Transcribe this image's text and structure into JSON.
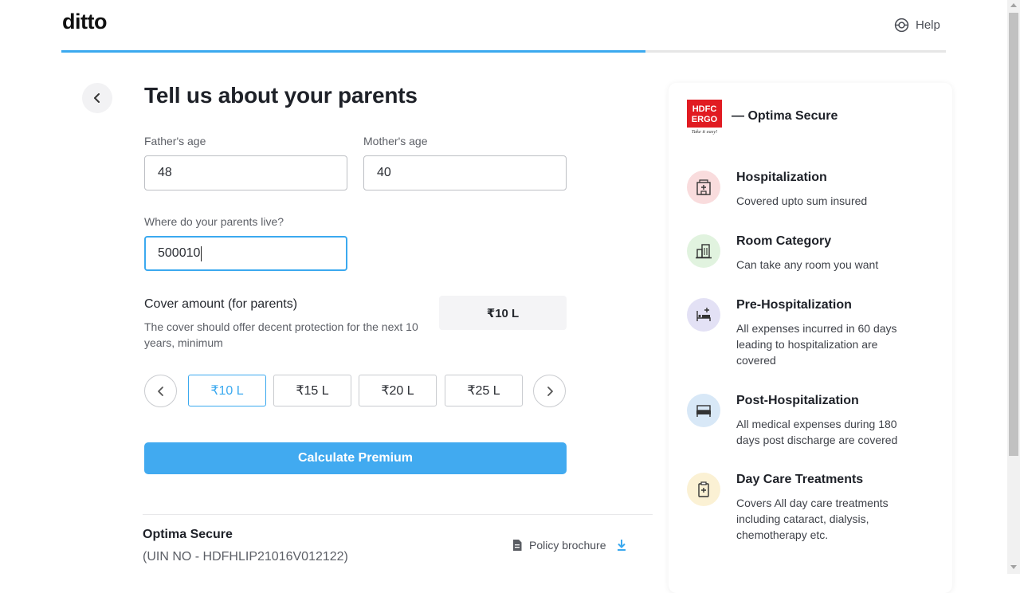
{
  "header": {
    "logo": "ditto",
    "help_label": "Help",
    "progress_percent": 66
  },
  "form": {
    "title": "Tell us about your parents",
    "father_age_label": "Father's age",
    "father_age_value": "48",
    "mother_age_label": "Mother's age",
    "mother_age_value": "40",
    "location_label": "Where do your parents live?",
    "location_value": "500010",
    "cover_title": "Cover amount (for parents)",
    "cover_desc": "The cover should offer decent protection for the next 10 years, minimum",
    "cover_selected": "₹10 L",
    "cover_options": [
      "₹10 L",
      "₹15 L",
      "₹20 L",
      "₹25 L"
    ],
    "calculate_label": "Calculate Premium"
  },
  "plan": {
    "name": "Optima Secure",
    "uin": "(UIN NO - HDFHLIP21016V012122)",
    "brochure_label": "Policy brochure"
  },
  "sidebar": {
    "insurer_logo_text": [
      "HDFC",
      "ERGO",
      "Take it easy!"
    ],
    "plan_title": "— Optima Secure",
    "features": [
      {
        "title": "Hospitalization",
        "desc": "Covered upto sum insured",
        "icon": "hospital-icon",
        "color": "#f9dcdd"
      },
      {
        "title": "Room Category",
        "desc": "Can take any room you want",
        "icon": "building-icon",
        "color": "#e1f3df"
      },
      {
        "title": "Pre-Hospitalization",
        "desc": "All expenses incurred in 60 days leading to hospitalization are covered",
        "icon": "bed-plus-icon",
        "color": "#e3e1f5"
      },
      {
        "title": "Post-Hospitalization",
        "desc": "All medical expenses during 180 days post discharge are covered",
        "icon": "bed-icon",
        "color": "#d8e8f7"
      },
      {
        "title": "Day Care Treatments",
        "desc": "Covers All day care treatments including cataract, dialysis, chemotherapy etc.",
        "icon": "clipboard-plus-icon",
        "color": "#fbf1d4"
      }
    ]
  },
  "colors": {
    "accent": "#3ba9ef",
    "button": "#41aaf0",
    "insurer_red": "#e11b22"
  }
}
